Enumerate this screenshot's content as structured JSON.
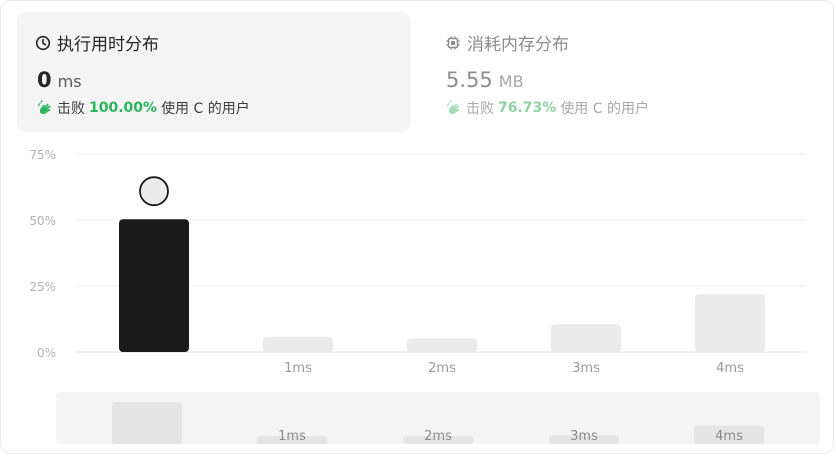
{
  "runtime": {
    "title": "执行用时分布",
    "value": "0",
    "unit": "ms",
    "beat_prefix": "击败",
    "beat_pct": "100.00%",
    "beat_suffix": "使用 C 的用户"
  },
  "memory": {
    "title": "消耗内存分布",
    "value": "5.55",
    "unit": "MB",
    "beat_prefix": "击败",
    "beat_pct": "76.73%",
    "beat_suffix": "使用 C 的用户"
  },
  "colors": {
    "accent_green": "#2db55d",
    "selected_bar": "#1a1a1a",
    "bar": "#ebebeb"
  },
  "chart_data": {
    "type": "bar",
    "categories": [
      "",
      "1ms",
      "2ms",
      "3ms",
      "4ms"
    ],
    "values": [
      50.3,
      5.8,
      5.2,
      10.5,
      21.9
    ],
    "y_ticks": [
      "0%",
      "25%",
      "50%",
      "75%"
    ],
    "ylim": [
      0,
      75
    ],
    "grid": true,
    "selected_index": 0,
    "overview": {
      "categories": [
        "",
        "1ms",
        "2ms",
        "3ms",
        "4ms"
      ]
    }
  }
}
